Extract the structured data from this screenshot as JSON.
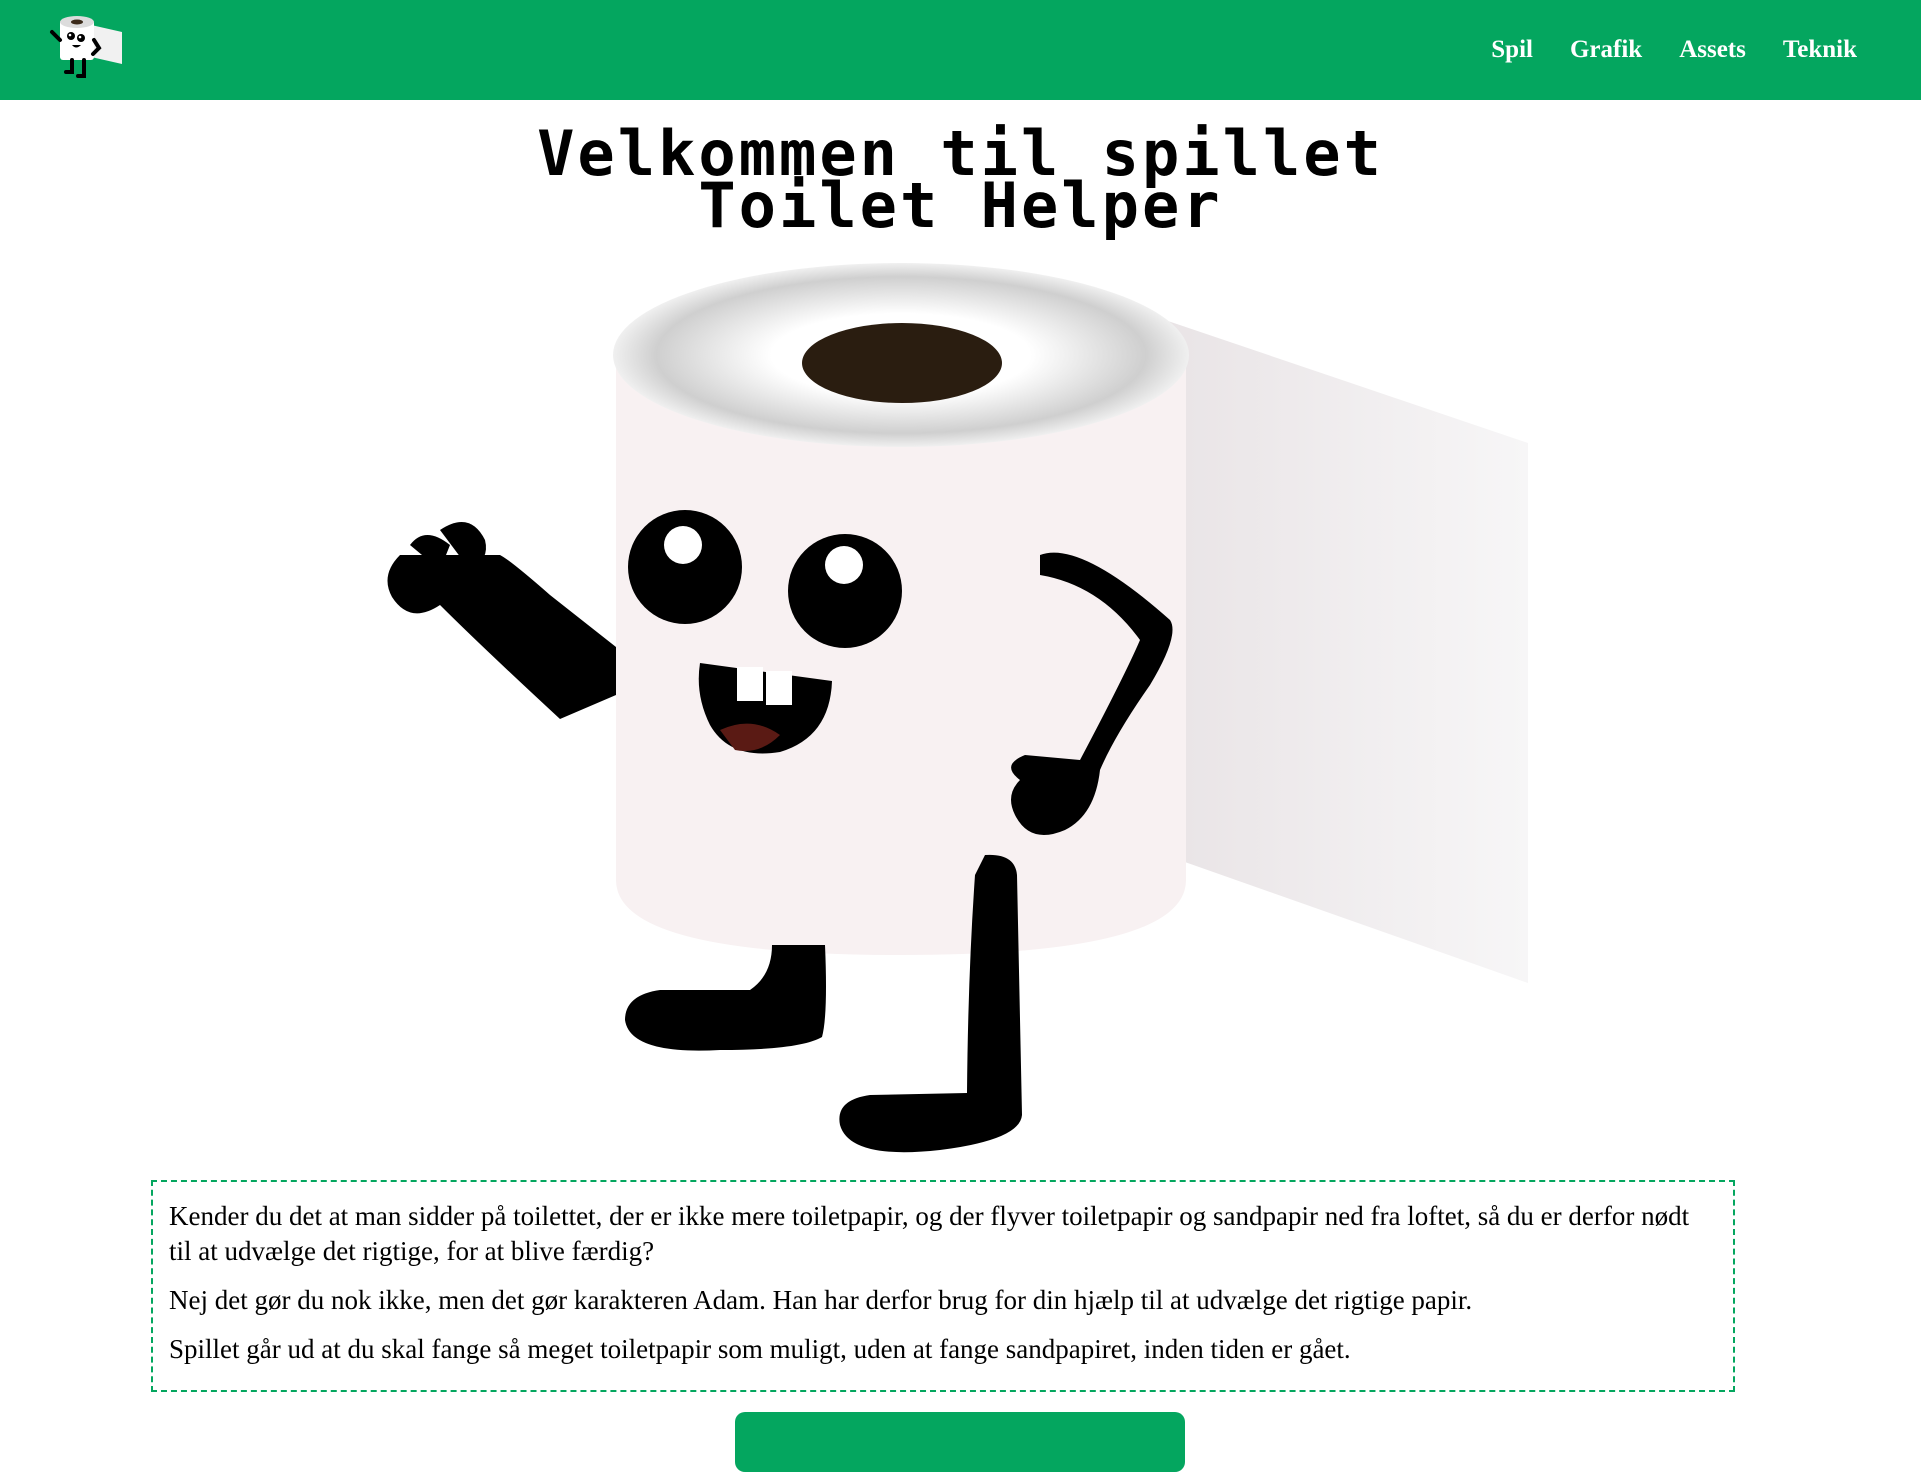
{
  "header": {
    "logo_icon": "toilet-roll-mascot-icon",
    "nav": [
      {
        "label": "Spil"
      },
      {
        "label": "Grafik"
      },
      {
        "label": "Assets"
      },
      {
        "label": "Teknik"
      }
    ],
    "background_color": "#04a65f"
  },
  "main": {
    "title_line1": "Velkommen til spillet",
    "title_line2": "Toilet Helper",
    "hero_image": "toilet-roll-mascot-illustration",
    "paragraphs": [
      "Kender du det at man sidder på toilettet, der er ikke mere toiletpapir, og der flyver toiletpapir og sandpapir ned fra loftet, så du er derfor nødt til at udvælge det rigtige, for at blive færdig?",
      "Nej det gør du nok ikke, men det gør karakteren Adam. Han har derfor brug for din hjælp til at udvælge det rigtige papir.",
      "Spillet går ud at du skal fange så meget toiletpapir som muligt, uden at fange sandpapiret, inden tiden er gået."
    ],
    "play_button_label": ""
  }
}
